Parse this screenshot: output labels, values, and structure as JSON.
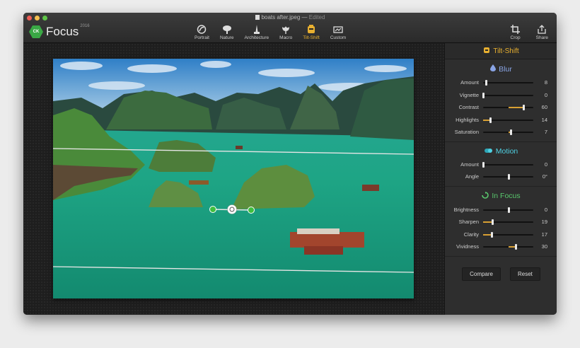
{
  "window": {
    "file_name": "boats after.jpeg",
    "edited_label": "Edited"
  },
  "app": {
    "logo_initials": "CK",
    "name": "Focus",
    "year": "2016"
  },
  "modes": [
    {
      "label": "Portrait",
      "icon": "portrait-icon"
    },
    {
      "label": "Nature",
      "icon": "tree-icon"
    },
    {
      "label": "Architecture",
      "icon": "monument-icon"
    },
    {
      "label": "Macro",
      "icon": "flower-icon"
    },
    {
      "label": "Tilt-Shift",
      "icon": "tilt-shift-icon",
      "active": true
    },
    {
      "label": "Custom",
      "icon": "custom-icon"
    }
  ],
  "tools": [
    {
      "label": "Crop",
      "icon": "crop-icon"
    },
    {
      "label": "Share",
      "icon": "share-icon"
    }
  ],
  "panel": {
    "title": "Tilt-Shift",
    "blur": {
      "title": "Blur",
      "rows": [
        {
          "label": "Amount",
          "value": "8",
          "level": 0.05
        },
        {
          "label": "Vignette",
          "value": "0",
          "level": 0
        },
        {
          "label": "Contrast",
          "value": "60",
          "level": 0.8
        },
        {
          "label": "Highlights",
          "value": "14",
          "level": 0.14
        },
        {
          "label": "Saturation",
          "value": "7",
          "level": 0.55
        }
      ]
    },
    "motion": {
      "title": "Motion",
      "rows": [
        {
          "label": "Amount",
          "value": "0",
          "level": 0
        },
        {
          "label": "Angle",
          "value": "0°",
          "level": 0.5
        }
      ]
    },
    "in_focus": {
      "title": "In Focus",
      "rows": [
        {
          "label": "Brightness",
          "value": "0",
          "level": 0.5
        },
        {
          "label": "Sharpen",
          "value": "19",
          "level": 0.19
        },
        {
          "label": "Clarity",
          "value": "17",
          "level": 0.17
        },
        {
          "label": "Vividness",
          "value": "30",
          "level": 0.65
        }
      ]
    },
    "compare_label": "Compare",
    "reset_label": "Reset"
  },
  "colors": {
    "accent": "#e8b030",
    "focus_handle": "#3fbf3f",
    "logo_green": "#3aa845"
  }
}
